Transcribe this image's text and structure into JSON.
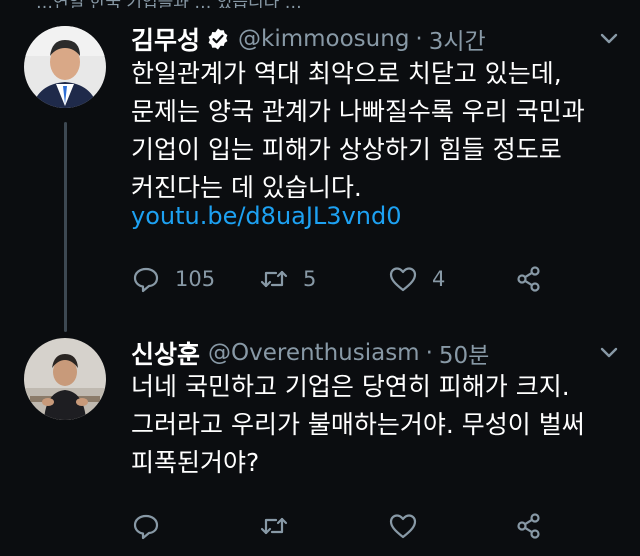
{
  "top_partial_text": "…연일 한국 기업들과 … 있습니다 …",
  "tweets": [
    {
      "display_name": "김무성",
      "verified": true,
      "handle": "@kimmoosung",
      "time": "3시간",
      "body": [
        "한일관계가 역대 최악으로 치닫고 있는데,",
        "문제는 양국 관계가 나빠질수록 우리 국민과",
        "기업이 입는 피해가 상상하기 힘들 정도로",
        "커진다는 데 있습니다."
      ],
      "link": "youtu.be/d8uaJL3vnd0",
      "replies": "105",
      "retweets": "5",
      "likes": "4"
    },
    {
      "display_name": "신상훈",
      "verified": false,
      "handle": "@Overenthusiasm",
      "time": "50분",
      "body": [
        "너네 국민하고 기업은 당연히 피해가 크지.",
        "그러라고 우리가 불매하는거야. 무성이 벌써",
        "피폭된거야?"
      ]
    }
  ],
  "icons": {
    "reply": "reply-icon",
    "retweet": "retweet-icon",
    "like": "heart-icon",
    "share": "share-icon",
    "menu": "chevron-down-icon",
    "verified": "verified-badge-icon"
  },
  "colors": {
    "background": "#0b0d10",
    "muted": "#8899a6",
    "link": "#1da1f2",
    "thread_line": "#3d4852"
  }
}
